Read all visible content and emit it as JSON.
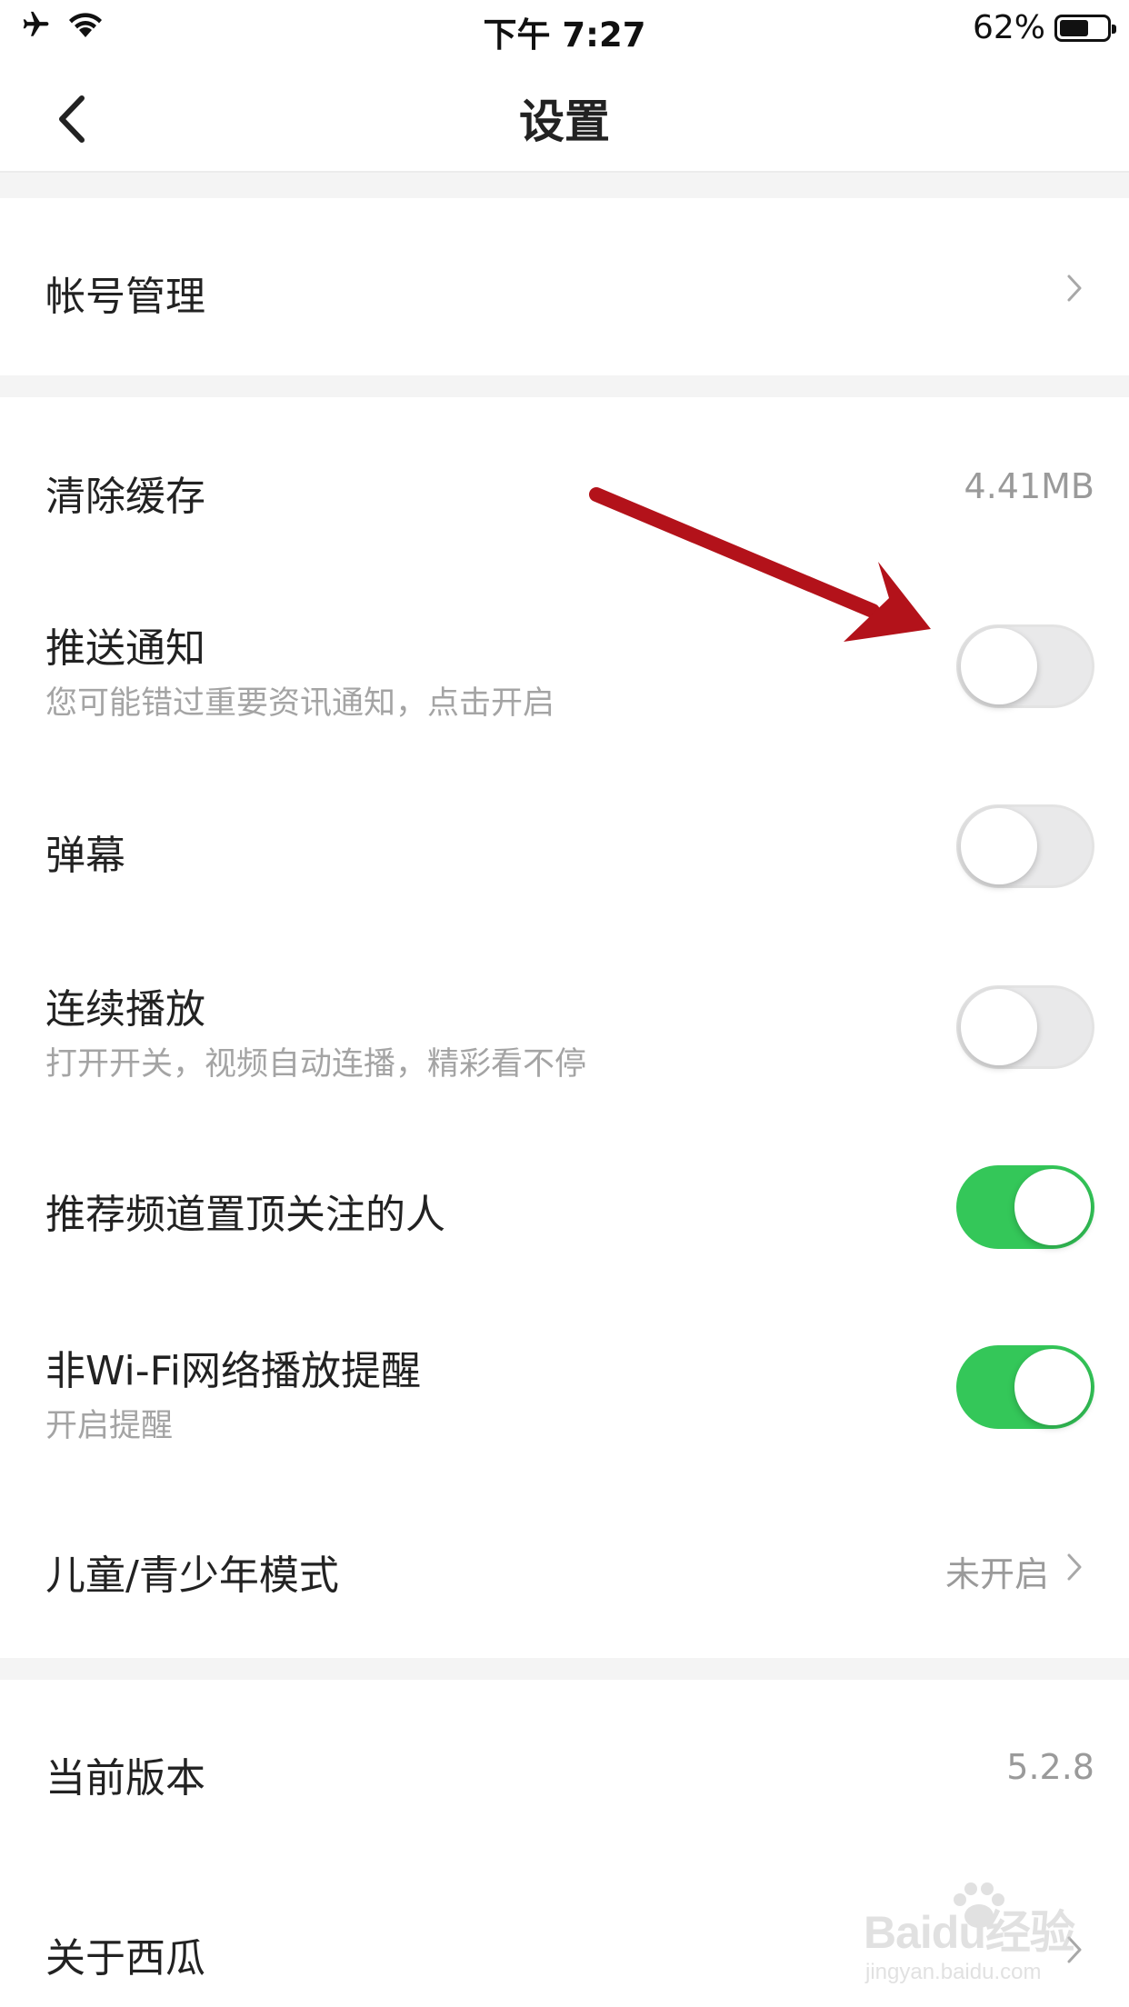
{
  "status_bar": {
    "time": "下午 7:27",
    "battery_percent": "62%",
    "battery_level": 0.62,
    "icons": [
      "airplane-icon",
      "wifi-icon",
      "battery-icon"
    ]
  },
  "nav": {
    "title": "设置",
    "back_icon": "chevron-left-icon"
  },
  "rows": {
    "account": {
      "title": "帐号管理"
    },
    "cache": {
      "title": "清除缓存",
      "value": "4.41MB"
    },
    "push": {
      "title": "推送通知",
      "subtitle": "您可能错过重要资讯通知，点击开启",
      "on": false
    },
    "danmaku": {
      "title": "弹幕",
      "on": false
    },
    "autoplay": {
      "title": "连续播放",
      "subtitle": "打开开关，视频自动连播，精彩看不停",
      "on": false
    },
    "pin_followed": {
      "title": "推荐频道置顶关注的人",
      "on": true
    },
    "non_wifi": {
      "title": "非Wi-Fi网络播放提醒",
      "subtitle": "开启提醒",
      "on": true
    },
    "teen_mode": {
      "title": "儿童/青少年模式",
      "value": "未开启"
    },
    "version": {
      "title": "当前版本",
      "value": "5.2.8"
    },
    "about": {
      "title": "关于西瓜"
    }
  },
  "watermark": {
    "brand": "Baidu经验",
    "site": "jingyan.baidu.com"
  },
  "colors": {
    "toggle_on": "#34c759",
    "toggle_off": "#e9e9ea",
    "section_gap": "#f4f4f4",
    "annotation_arrow": "#b3121a"
  }
}
